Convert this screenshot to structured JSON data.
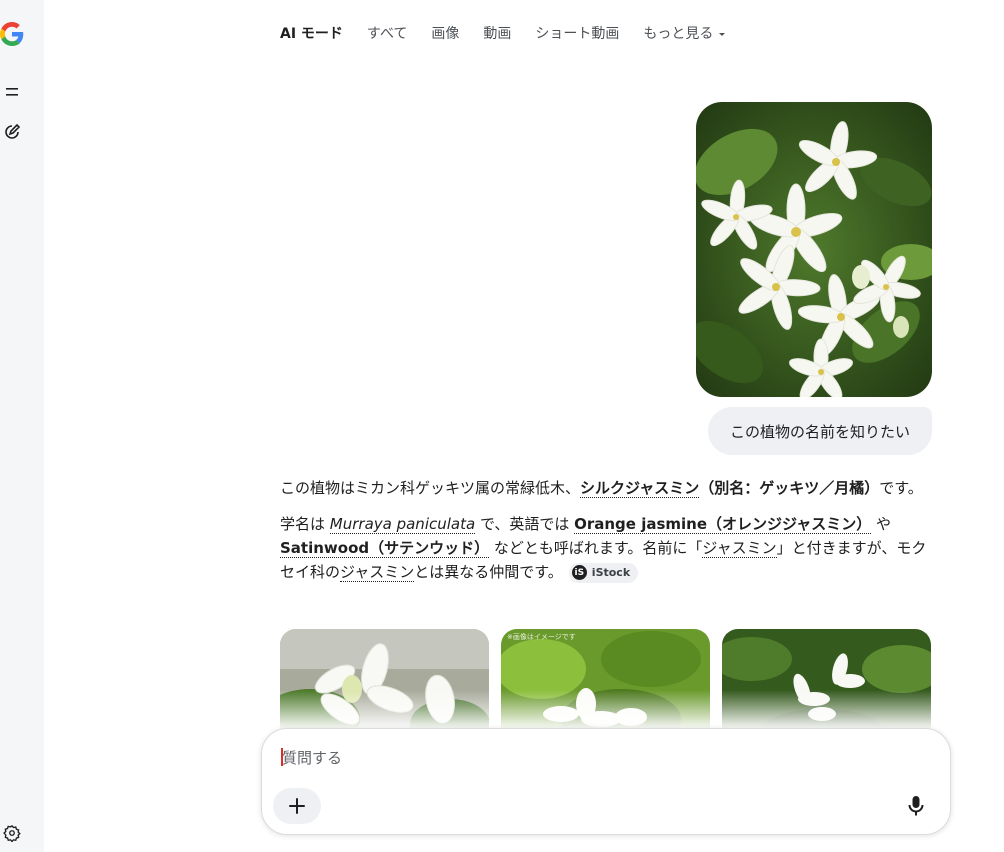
{
  "icons": {
    "logo": "google-g-icon",
    "menu": "menu-icon",
    "new_chat": "new-chat-icon",
    "settings": "gear-icon",
    "more": "chevron-down-icon",
    "add": "plus-icon",
    "mic": "mic-icon"
  },
  "tabs": {
    "ai_mode": "AI モード",
    "all": "すべて",
    "images": "画像",
    "videos": "動画",
    "short_videos": "ショート動画",
    "more": "もっと見る"
  },
  "user_message": "この植物の名前を知りたい",
  "answer": {
    "p1_a": "この植物はミカン科ゲッキツ属の常緑低木、",
    "p1_name": "シルクジャスミン",
    "p1_alias": "（別名：ゲッキツ／月橘）",
    "p1_end": "です。",
    "p2_a": "学名は ",
    "p2_sci": "Murraya paniculata",
    "p2_b": " で、英語では ",
    "p2_en1": "Orange jasmine（オレンジジャスミン）",
    "p2_c": " や ",
    "p2_en2": "Satinwood（サテンウッド）",
    "p2_d": " などとも呼ばれます。名前に「",
    "p2_jas1": "ジャスミン",
    "p2_e": "」と付きますが、モクセイ科の",
    "p2_jas2": "ジャスミン",
    "p2_f": "とは異なる仲間です。",
    "source": "iStock",
    "source_logo": "iS"
  },
  "thumbs": {
    "caption2": "※画像はイメージです"
  },
  "composer": {
    "placeholder": "質問する"
  }
}
